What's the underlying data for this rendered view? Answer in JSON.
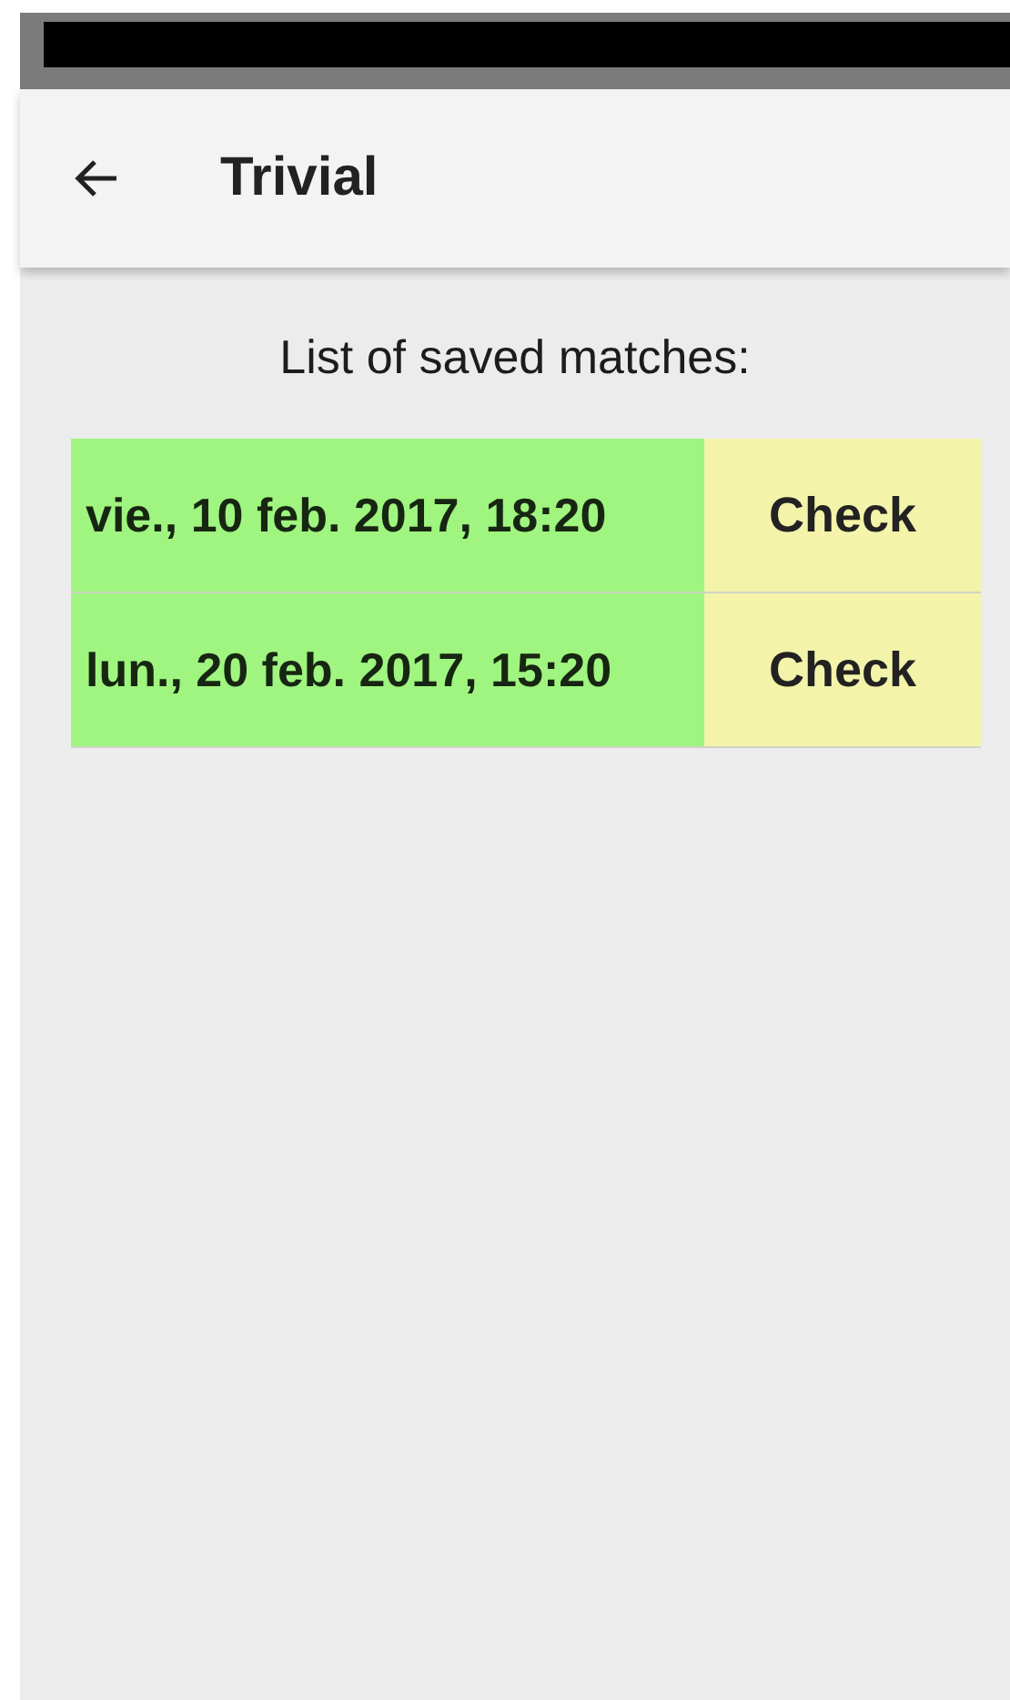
{
  "app_bar": {
    "title": "Trivial"
  },
  "heading": "List of saved matches:",
  "matches": [
    {
      "date": "vie., 10 feb. 2017, 18:20",
      "action": "Check"
    },
    {
      "date": "lun., 20 feb. 2017, 15:20",
      "action": "Check"
    }
  ]
}
